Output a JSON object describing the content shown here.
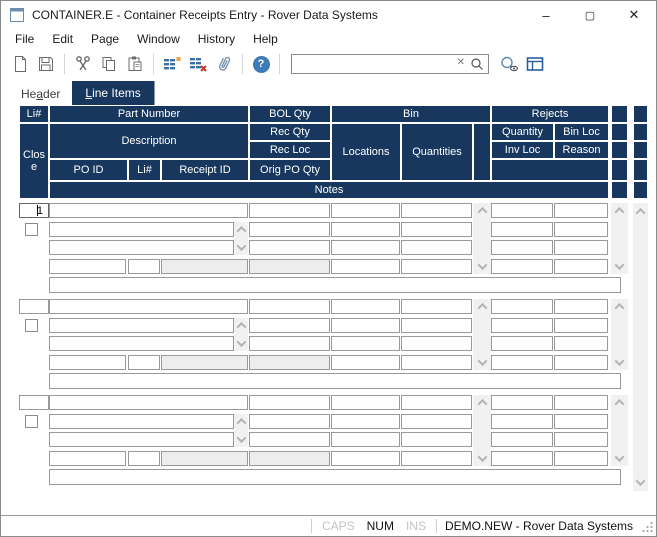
{
  "window": {
    "title": "CONTAINER.E - Container Receipts Entry - Rover Data Systems",
    "minimize_glyph": "–",
    "maximize_glyph": "▢",
    "close_glyph": "✕"
  },
  "menu_bar": {
    "items": [
      "File",
      "Edit",
      "Page",
      "Window",
      "History",
      "Help"
    ]
  },
  "toolbar": {
    "help_glyph": "?",
    "search": {
      "value": ""
    },
    "clear_glyph": "✕",
    "icon_names": [
      "new-document",
      "save",
      "cut",
      "copy",
      "paste",
      "insert-line",
      "delete-line",
      "attachment",
      "help",
      "search-clear",
      "search",
      "lookup-view",
      "panel-layout"
    ]
  },
  "tabs": [
    {
      "pre": "He",
      "accel": "a",
      "post": "der",
      "active": false
    },
    {
      "pre": "",
      "accel": "L",
      "post": "ine Items",
      "active": true
    }
  ],
  "grid_header": {
    "li": "Li#",
    "part_number": "Part Number",
    "bol_qty": "BOL Qty",
    "bin": "Bin",
    "rejects": "Rejects",
    "close": "Close",
    "description": "Description",
    "rec_qty": "Rec Qty",
    "rec_loc": "Rec Loc",
    "locations": "Locations",
    "quantities": "Quantities",
    "quantity": "Quantity",
    "bin_loc": "Bin Loc",
    "inv_loc": "Inv Loc",
    "reason": "Reason",
    "po_id": "PO ID",
    "li_2": "Li#",
    "receipt_id": "Receipt ID",
    "orig_po_qty": "Orig PO Qty",
    "notes": "Notes"
  },
  "rows": [
    {
      "li_value": "1",
      "focused": true
    },
    {
      "li_value": "",
      "focused": false
    },
    {
      "li_value": "",
      "focused": false
    }
  ],
  "status_bar": {
    "caps": "CAPS",
    "num": "NUM",
    "ins": "INS",
    "session": "DEMO.NEW - Rover Data Systems"
  },
  "colors": {
    "header_navy": "#17375e",
    "field_border": "#999999",
    "disabled_field": "#ededed",
    "accent_blue": "#3a6ea5",
    "help_blue": "#3f7ab8",
    "delete_red": "#c0392b",
    "insert_orange": "#e8a33d"
  }
}
